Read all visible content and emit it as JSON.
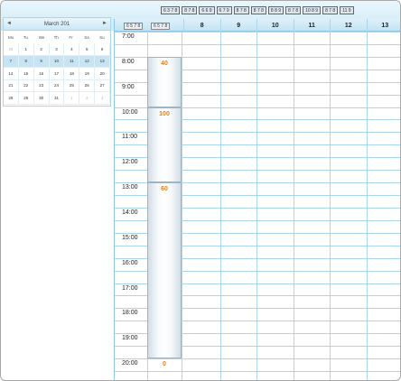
{
  "calendar": {
    "title": "March 201",
    "prev": "◄",
    "next": "►",
    "dow": [
      "Mo",
      "Tu",
      "We",
      "Th",
      "Fr",
      "Sa",
      "Su"
    ],
    "days": [
      {
        "d": "28",
        "other": true
      },
      {
        "d": "1"
      },
      {
        "d": "2"
      },
      {
        "d": "3"
      },
      {
        "d": "4"
      },
      {
        "d": "5"
      },
      {
        "d": "6"
      },
      {
        "d": "7",
        "sel": true
      },
      {
        "d": "8",
        "sel": true
      },
      {
        "d": "9",
        "sel": true
      },
      {
        "d": "10",
        "sel": true
      },
      {
        "d": "11",
        "sel": true
      },
      {
        "d": "12",
        "sel": true
      },
      {
        "d": "13",
        "sel": true
      },
      {
        "d": "14"
      },
      {
        "d": "15"
      },
      {
        "d": "16"
      },
      {
        "d": "17"
      },
      {
        "d": "18"
      },
      {
        "d": "19"
      },
      {
        "d": "20"
      },
      {
        "d": "21"
      },
      {
        "d": "22"
      },
      {
        "d": "23"
      },
      {
        "d": "24"
      },
      {
        "d": "25"
      },
      {
        "d": "26"
      },
      {
        "d": "27"
      },
      {
        "d": "28"
      },
      {
        "d": "29"
      },
      {
        "d": "30"
      },
      {
        "d": "31"
      },
      {
        "d": "1",
        "other": true
      },
      {
        "d": "2",
        "other": true
      },
      {
        "d": "3",
        "other": true
      }
    ]
  },
  "week_strip": [
    "6 3 7 8",
    "8 7 8",
    "6 6 9",
    "6 7 9",
    "8 7 8",
    "8 7 8",
    "8 8 9",
    "8 7 8",
    "10 8 9",
    "8 7 8",
    "11 9"
  ],
  "range_labels": [
    "6 5 7 8",
    "6 5 7 8"
  ],
  "days": [
    "8",
    "9",
    "10",
    "11",
    "12",
    "13"
  ],
  "times": [
    "7:00",
    "8:00",
    "9:00",
    "10:00",
    "11:00",
    "12:00",
    "13:00",
    "14:00",
    "15:00",
    "16:00",
    "17:00",
    "18:00",
    "19:00",
    "20:00"
  ],
  "blocks": [
    "40",
    "100",
    "60"
  ],
  "last_value": "0"
}
